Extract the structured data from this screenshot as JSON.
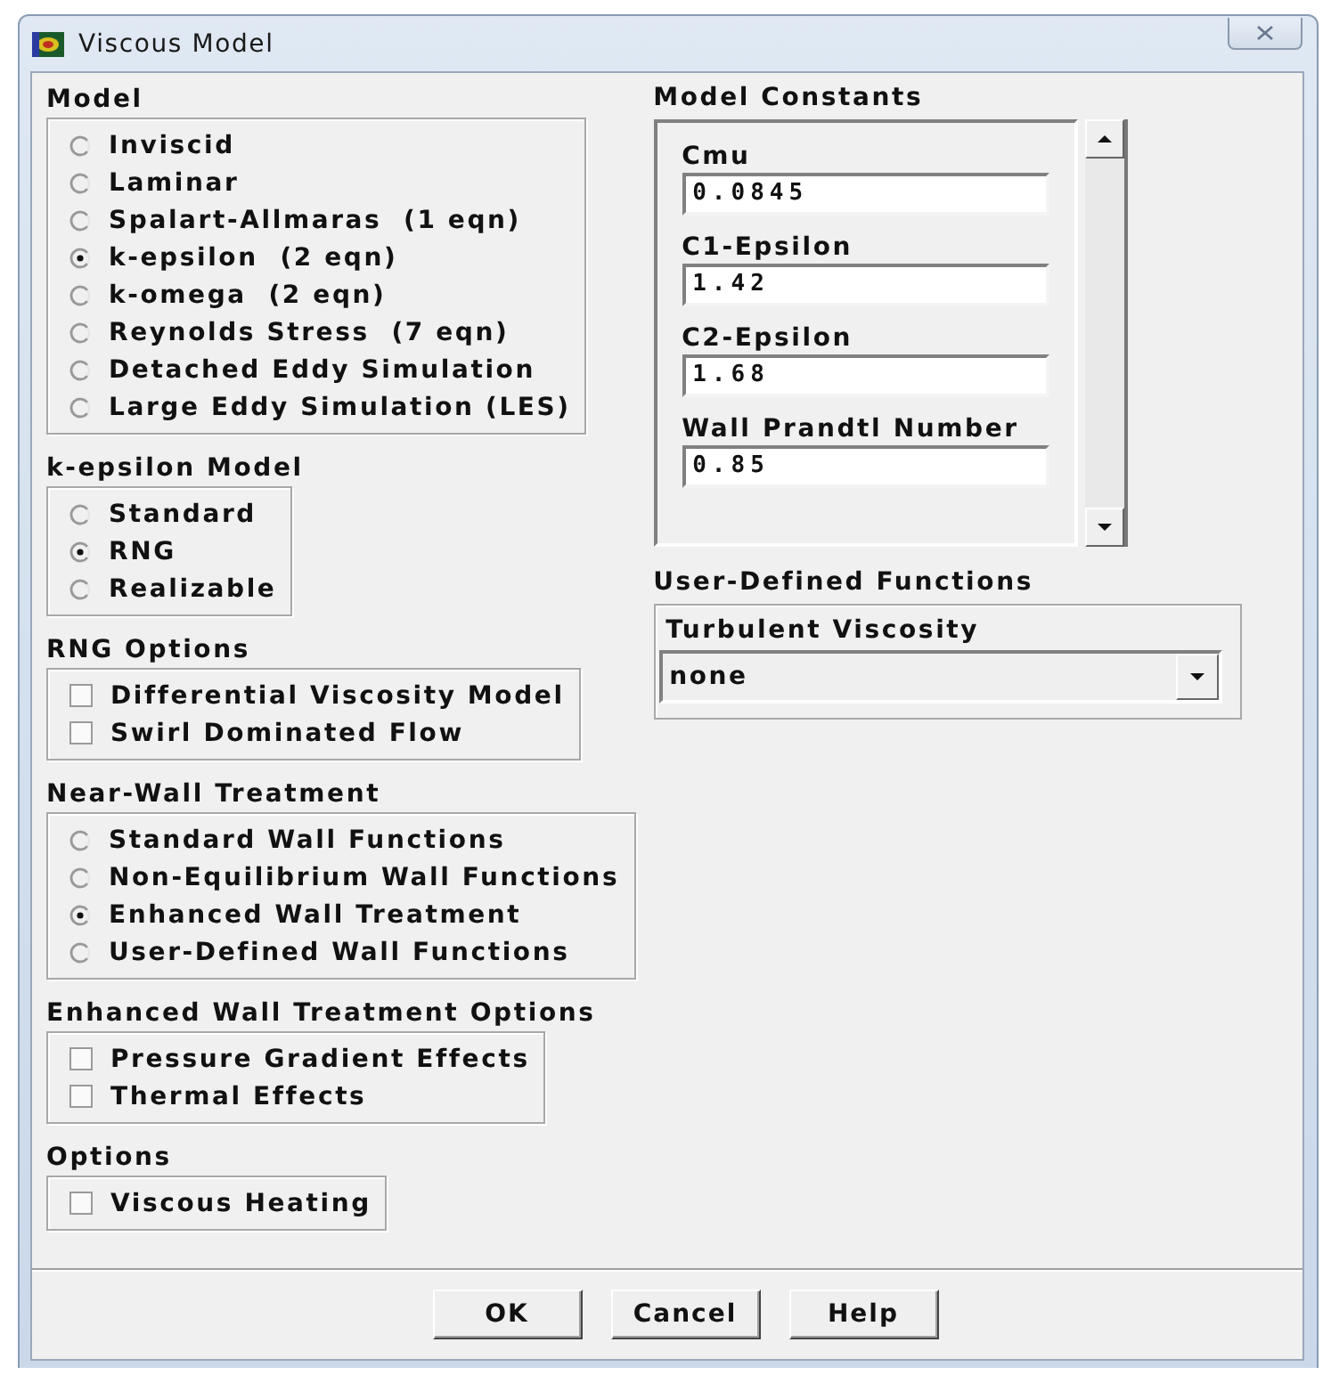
{
  "window": {
    "title": "Viscous Model"
  },
  "left_groups": [
    {
      "title": "Model",
      "kind": "radio",
      "options": [
        {
          "label": "Inviscid",
          "selected": false
        },
        {
          "label": "Laminar",
          "selected": false
        },
        {
          "label": "Spalart-Allmaras  (1 eqn)",
          "selected": false
        },
        {
          "label": "k-epsilon  (2 eqn)",
          "selected": true
        },
        {
          "label": "k-omega  (2 eqn)",
          "selected": false
        },
        {
          "label": "Reynolds Stress  (7 eqn)",
          "selected": false
        },
        {
          "label": "Detached Eddy Simulation",
          "selected": false
        },
        {
          "label": "Large Eddy Simulation (LES)",
          "selected": false
        }
      ]
    },
    {
      "title": "k-epsilon Model",
      "kind": "radio",
      "options": [
        {
          "label": "Standard",
          "selected": false
        },
        {
          "label": "RNG",
          "selected": true
        },
        {
          "label": "Realizable",
          "selected": false
        }
      ]
    },
    {
      "title": "RNG Options",
      "kind": "check",
      "options": [
        {
          "label": "Differential Viscosity Model",
          "checked": false
        },
        {
          "label": "Swirl Dominated Flow",
          "checked": false
        }
      ]
    },
    {
      "title": "Near-Wall Treatment",
      "kind": "radio",
      "options": [
        {
          "label": "Standard Wall Functions",
          "selected": false
        },
        {
          "label": "Non-Equilibrium Wall Functions",
          "selected": false
        },
        {
          "label": "Enhanced Wall Treatment",
          "selected": true
        },
        {
          "label": "User-Defined Wall Functions",
          "selected": false
        }
      ]
    },
    {
      "title": "Enhanced Wall Treatment Options",
      "kind": "check",
      "options": [
        {
          "label": "Pressure Gradient Effects",
          "checked": false
        },
        {
          "label": "Thermal Effects",
          "checked": false
        }
      ]
    },
    {
      "title": "Options",
      "kind": "check",
      "options": [
        {
          "label": "Viscous Heating",
          "checked": false
        }
      ]
    }
  ],
  "model_constants": {
    "title": "Model Constants",
    "fields": [
      {
        "label": "Cmu",
        "value": "0.0845"
      },
      {
        "label": "C1-Epsilon",
        "value": "1.42"
      },
      {
        "label": "C2-Epsilon",
        "value": "1.68"
      },
      {
        "label": "Wall Prandtl Number",
        "value": "0.85"
      }
    ]
  },
  "user_defined_functions": {
    "title": "User-Defined Functions",
    "dropdowns": [
      {
        "label": "Turbulent Viscosity",
        "value": "none"
      }
    ]
  },
  "buttons": [
    "OK",
    "Cancel",
    "Help"
  ]
}
